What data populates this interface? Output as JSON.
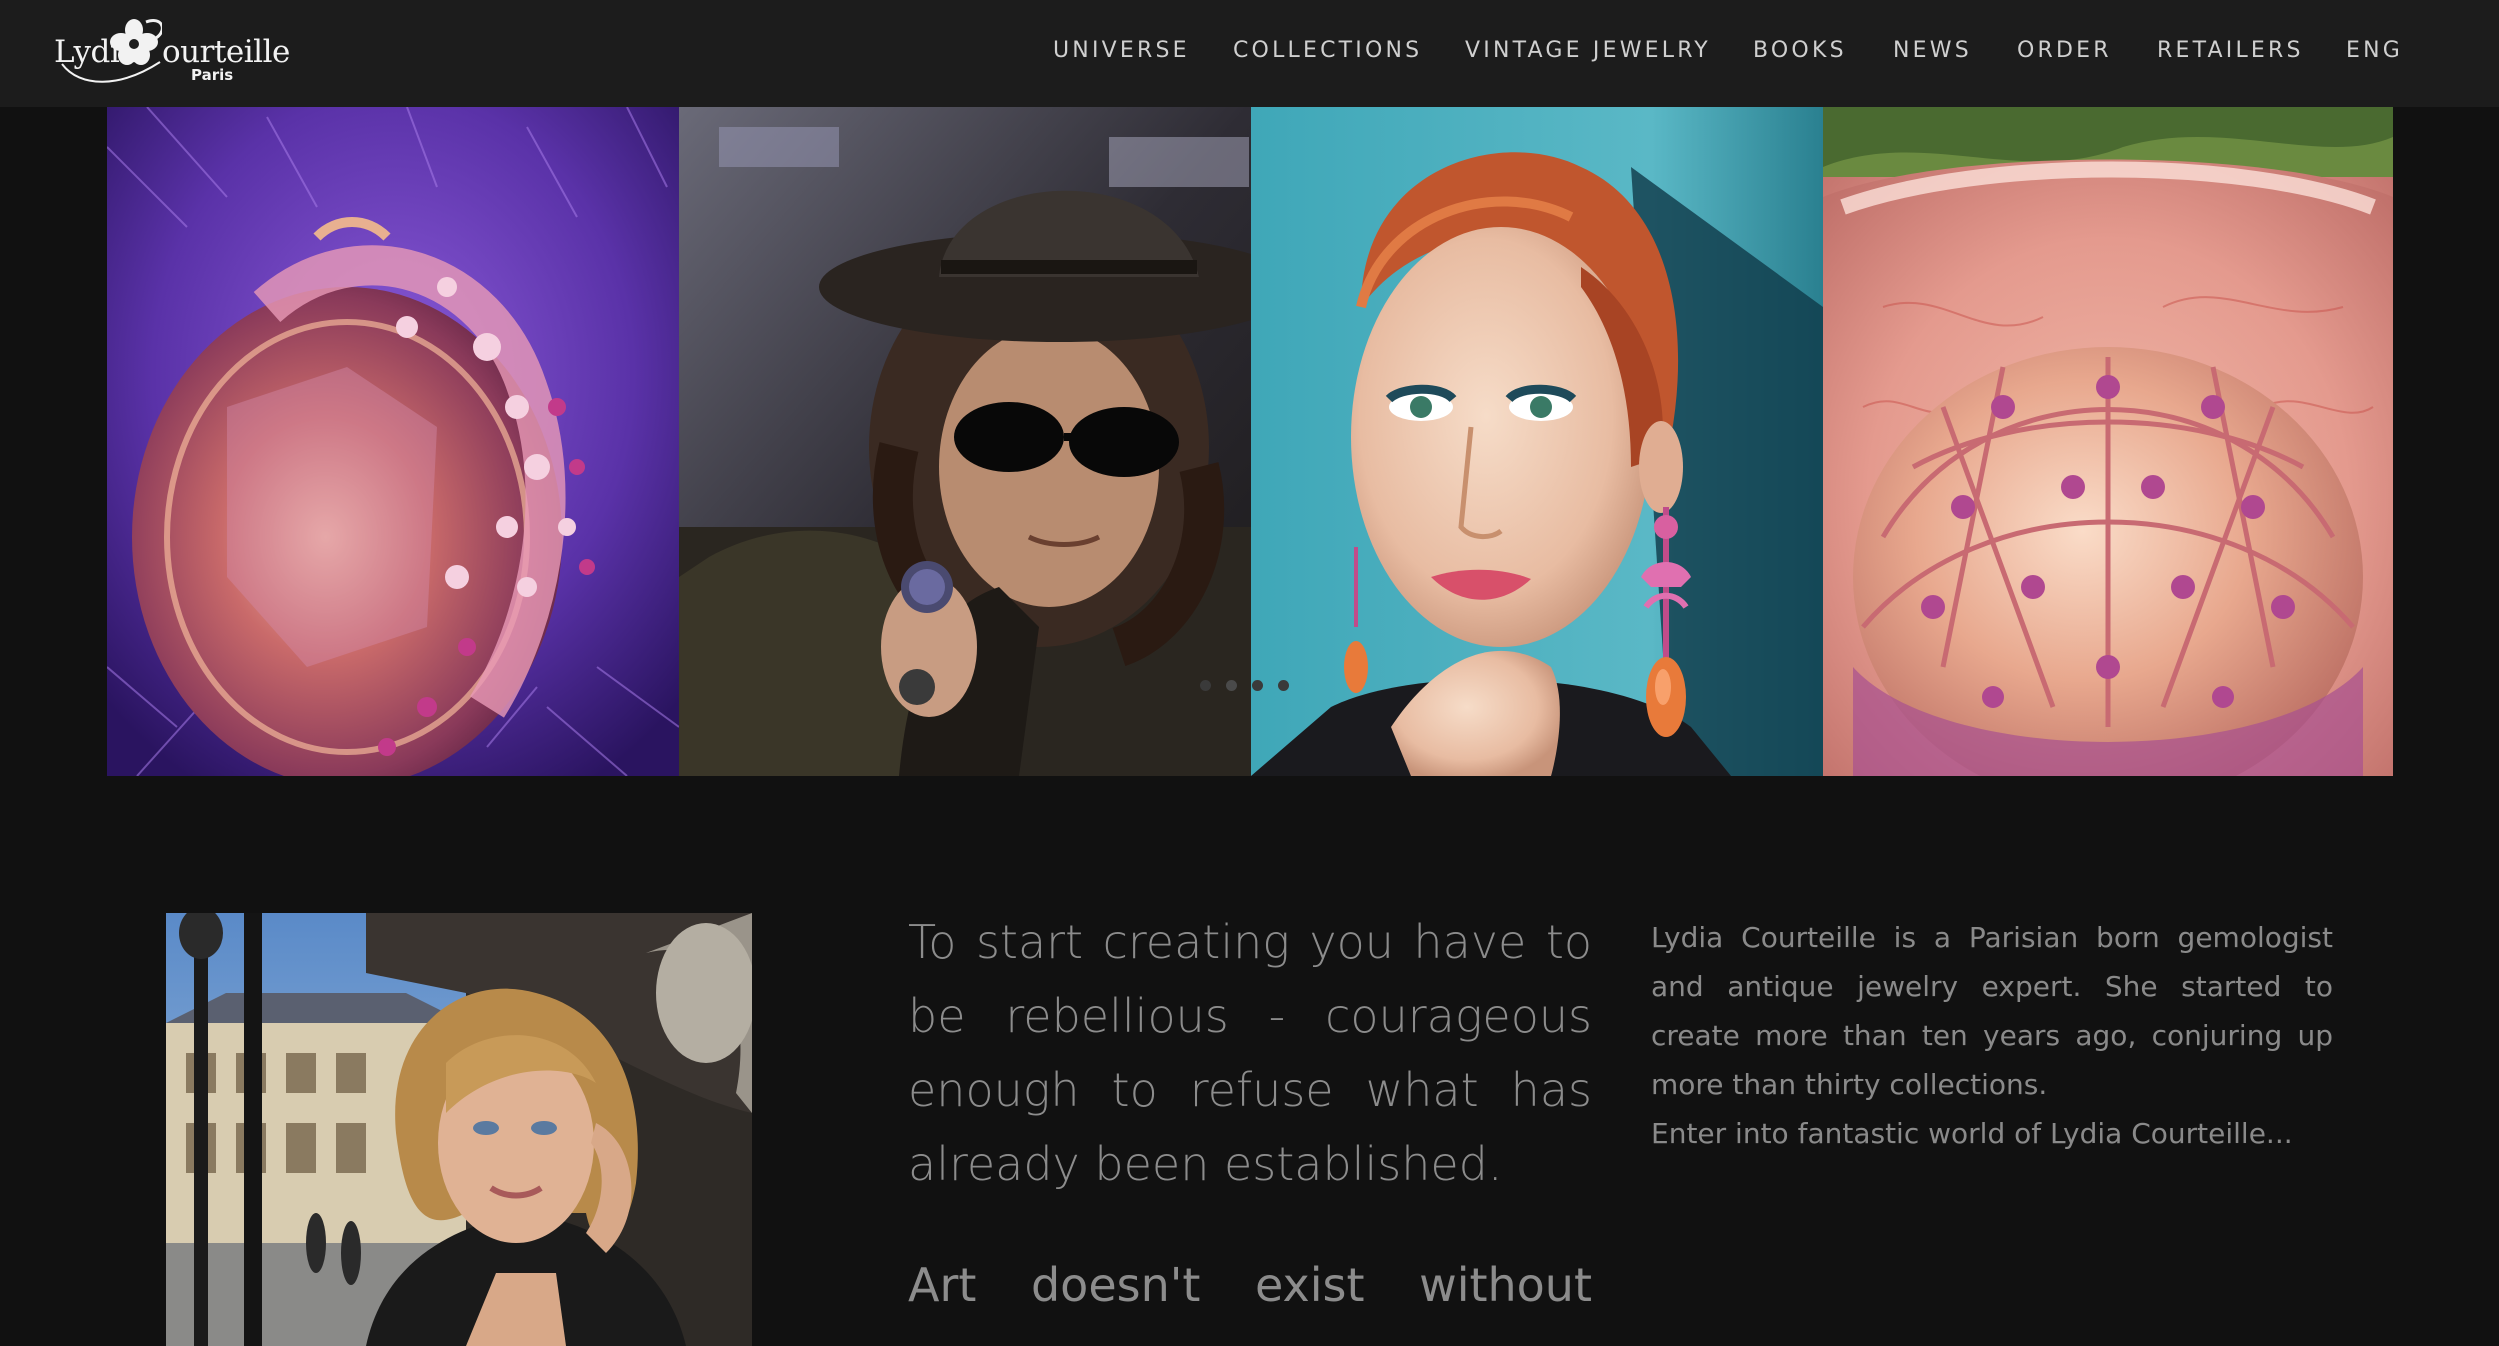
{
  "header": {
    "logo": {
      "name_left": "Lydia",
      "name_right": "ourteille",
      "city": "Paris"
    },
    "nav": [
      {
        "label": "UNIVERSE"
      },
      {
        "label": "COLLECTIONS"
      },
      {
        "label": "VINTAGE JEWELRY"
      },
      {
        "label": "BOOKS"
      },
      {
        "label": "NEWS"
      },
      {
        "label": "ORDER"
      },
      {
        "label": "RETAILERS"
      },
      {
        "label": "ENG"
      }
    ]
  },
  "slider": {
    "slides": [
      {
        "subject": "pink gemstone ring on purple flowers"
      },
      {
        "subject": "man in hat and sunglasses wearing rings"
      },
      {
        "subject": "red-haired woman wearing pink drop earrings"
      },
      {
        "subject": "rose gold domed ring on coral surface"
      }
    ],
    "dot_count": 4,
    "active_dot": 1
  },
  "content": {
    "quote": "To start creating you have to be rebellious - courageous enough to refuse what has already been established.",
    "quote2": "Art doesn't exist without",
    "bio_p1": "Lydia Courteille is a Parisian born gemologist and antique jewelry expert. She started to create more than ten years ago, conjuring up more than thirty collections.",
    "bio_p2": "Enter into fantastic world of Lydia Courteille..."
  },
  "colors": {
    "background": "#111111",
    "header": "#1c1c1c",
    "nav_text": "#cfcfcf",
    "body_text": "#8a8a8a"
  }
}
